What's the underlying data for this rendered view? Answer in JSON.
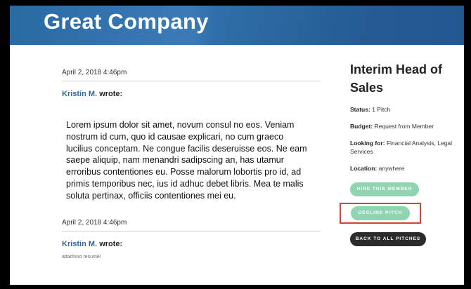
{
  "header": {
    "brand": "Great Company"
  },
  "posts": [
    {
      "date": "April 2, 2018 4:46pm",
      "author": "Kristin M.",
      "wrote": "wrote:",
      "body": "Lorem ipsum dolor sit amet, novum consul no eos. Veniam nostrum id cum, quo id causae explicari, no cum graeco lucilius conceptam. Ne congue facilis deseruisse eos. Ne eam saepe aliquip, nam menandri sadipscing an, has utamur erroribus contentiones eu. Posse malorum lobortis pro id, ad primis temporibus nec, ius id adhuc debet libris. Mea te malis soluta pertinax, officiis contentiones mei eu."
    },
    {
      "date": "April 2, 2018 4:46pm",
      "author": "Kristin M.",
      "wrote": "wrote:",
      "body": "attaching resume!"
    }
  ],
  "sidebar": {
    "title": "Interim Head of Sales",
    "status_label": "Status:",
    "status_value": "1 Pitch",
    "budget_label": "Budget:",
    "budget_value": "Request from Member",
    "looking_label": "Looking for:",
    "looking_value": "Financial Analysis, Legal Services",
    "location_label": "Location:",
    "location_value": "anywhere",
    "hire_label": "HIRE THIS MEMBER",
    "decline_label": "DECLINE PITCH",
    "back_label": "BACK TO ALL PITCHES"
  }
}
